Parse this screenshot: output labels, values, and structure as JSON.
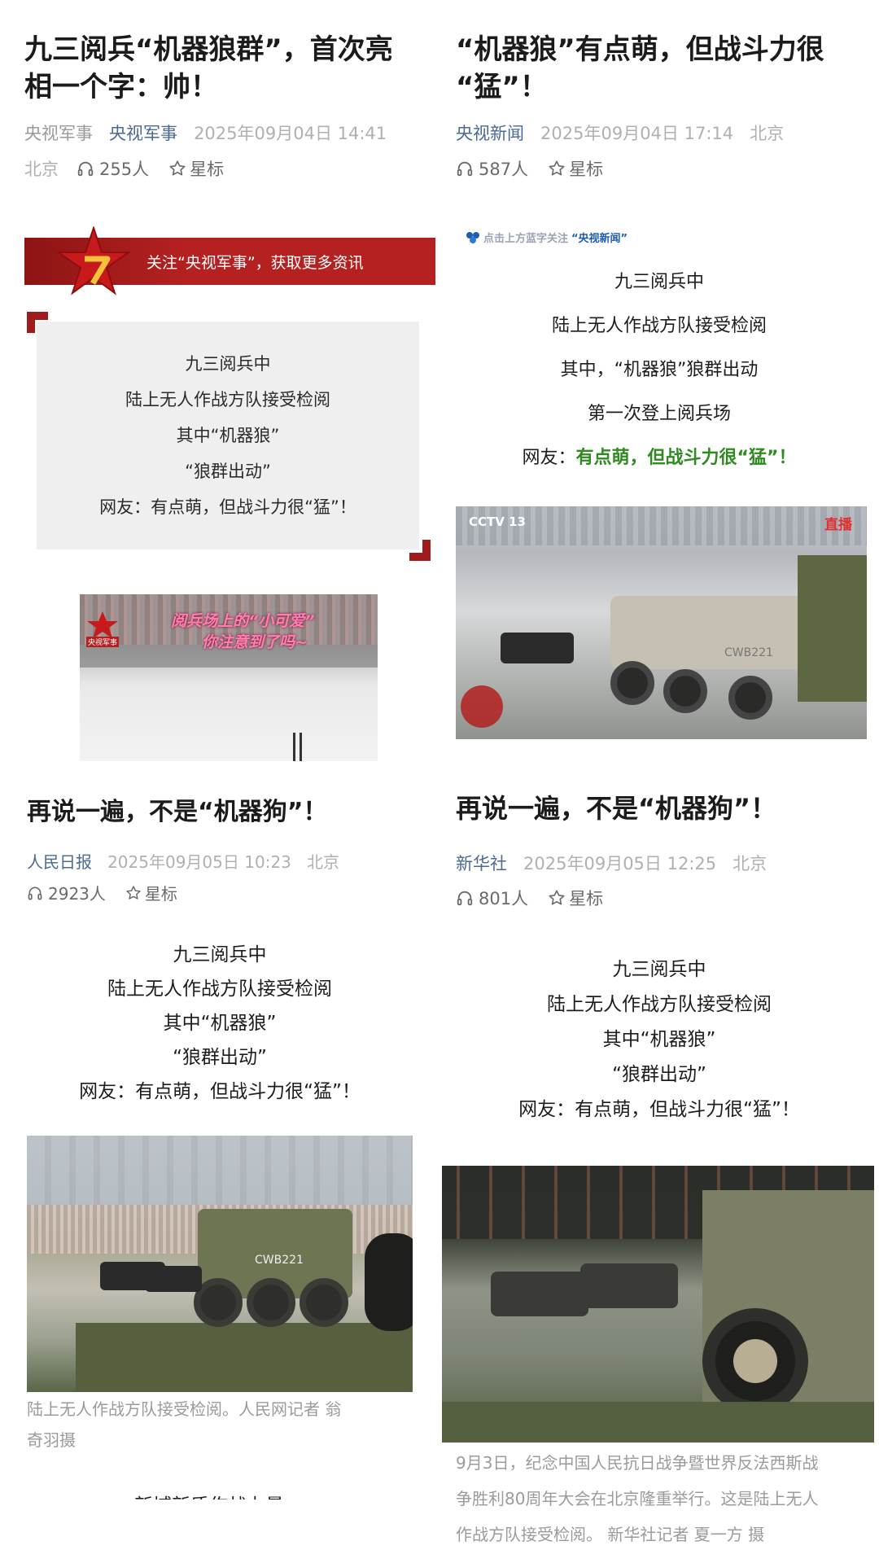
{
  "left": {
    "article1": {
      "title_line1": "九三阅兵“机器狼群”，首次亮",
      "title_line2": "相一个字：帅！",
      "source": "央视军事",
      "account": "央视军事",
      "datetime": "2025年09月04日 14:41",
      "location": "北京",
      "listens": "255人",
      "star_label": "星标",
      "banner_text": "关注“央视军事”，获取更多资讯",
      "quote_lines": [
        "九三阅兵中",
        "陆上无人作战方队接受检阅",
        "其中“机器狼”",
        "“狼群出动”",
        "网友：有点萌，但战斗力很“猛”！"
      ],
      "video_overlay_line1": "阅兵场上的“小可爱”",
      "video_overlay_line2": "你注意到了吗~",
      "video_logo_text": "央视军事"
    },
    "article3": {
      "title": "再说一遍，不是“机器狗”！",
      "source": "人民日报",
      "datetime": "2025年09月05日 10:23",
      "location": "北京",
      "listens": "2923人",
      "star_label": "星标",
      "body_lines": [
        "九三阅兵中",
        "陆上无人作战方队接受检阅",
        "其中“机器狼”",
        "“狼群出动”",
        "网友：有点萌，但战斗力很“猛”！"
      ],
      "photo_label": "CWB221",
      "caption_line1": "陆上无人作战方队接受检阅。人民网记者 翁",
      "caption_line2": "奇羽摄",
      "cut_text": "新域新质作战力量"
    }
  },
  "right": {
    "article2": {
      "title_line1": "“机器狼”有点萌，但战斗力很",
      "title_line2": "“猛”！",
      "account": "央视新闻",
      "datetime": "2025年09月04日 17:14",
      "location": "北京",
      "listens": "587人",
      "star_label": "星标",
      "follow_prefix": "点击上方蓝字关注",
      "follow_account": "“央视新闻”",
      "body_lines": [
        "九三阅兵中",
        "陆上无人作战方队接受检阅",
        "其中，“机器狼”狼群出动",
        "第一次登上阅兵场"
      ],
      "netizen_prefix": "网友：",
      "netizen_green": "有点萌，但战斗力很“猛”！",
      "video_channel": "CCTV 13",
      "video_live": "直播",
      "video_label": "CWB221"
    },
    "article4": {
      "title": "再说一遍，不是“机器狗”！",
      "source": "新华社",
      "datetime": "2025年09月05日 12:25",
      "location": "北京",
      "listens": "801人",
      "star_label": "星标",
      "body_lines": [
        "九三阅兵中",
        "陆上无人作战方队接受检阅",
        "其中“机器狼”",
        "“狼群出动”",
        "网友：有点萌，但战斗力很“猛”！"
      ],
      "caption_lines": [
        "9月3日，纪念中国人民抗日战争暨世界反法西斯战",
        "争胜利80周年大会在北京隆重举行。这是陆上无人",
        "作战方队接受检阅。 新华社记者 夏一方 摄"
      ]
    }
  },
  "colors": {
    "banner_red": "#b52121",
    "link_blue": "#4a6a94",
    "netizen_green": "#2f8a1f",
    "overlay_pink": "#ff7fb1"
  },
  "icons": {
    "headphones": "headphones-icon",
    "star": "star-outline-icon",
    "army_star": "red-star-logo-icon"
  }
}
